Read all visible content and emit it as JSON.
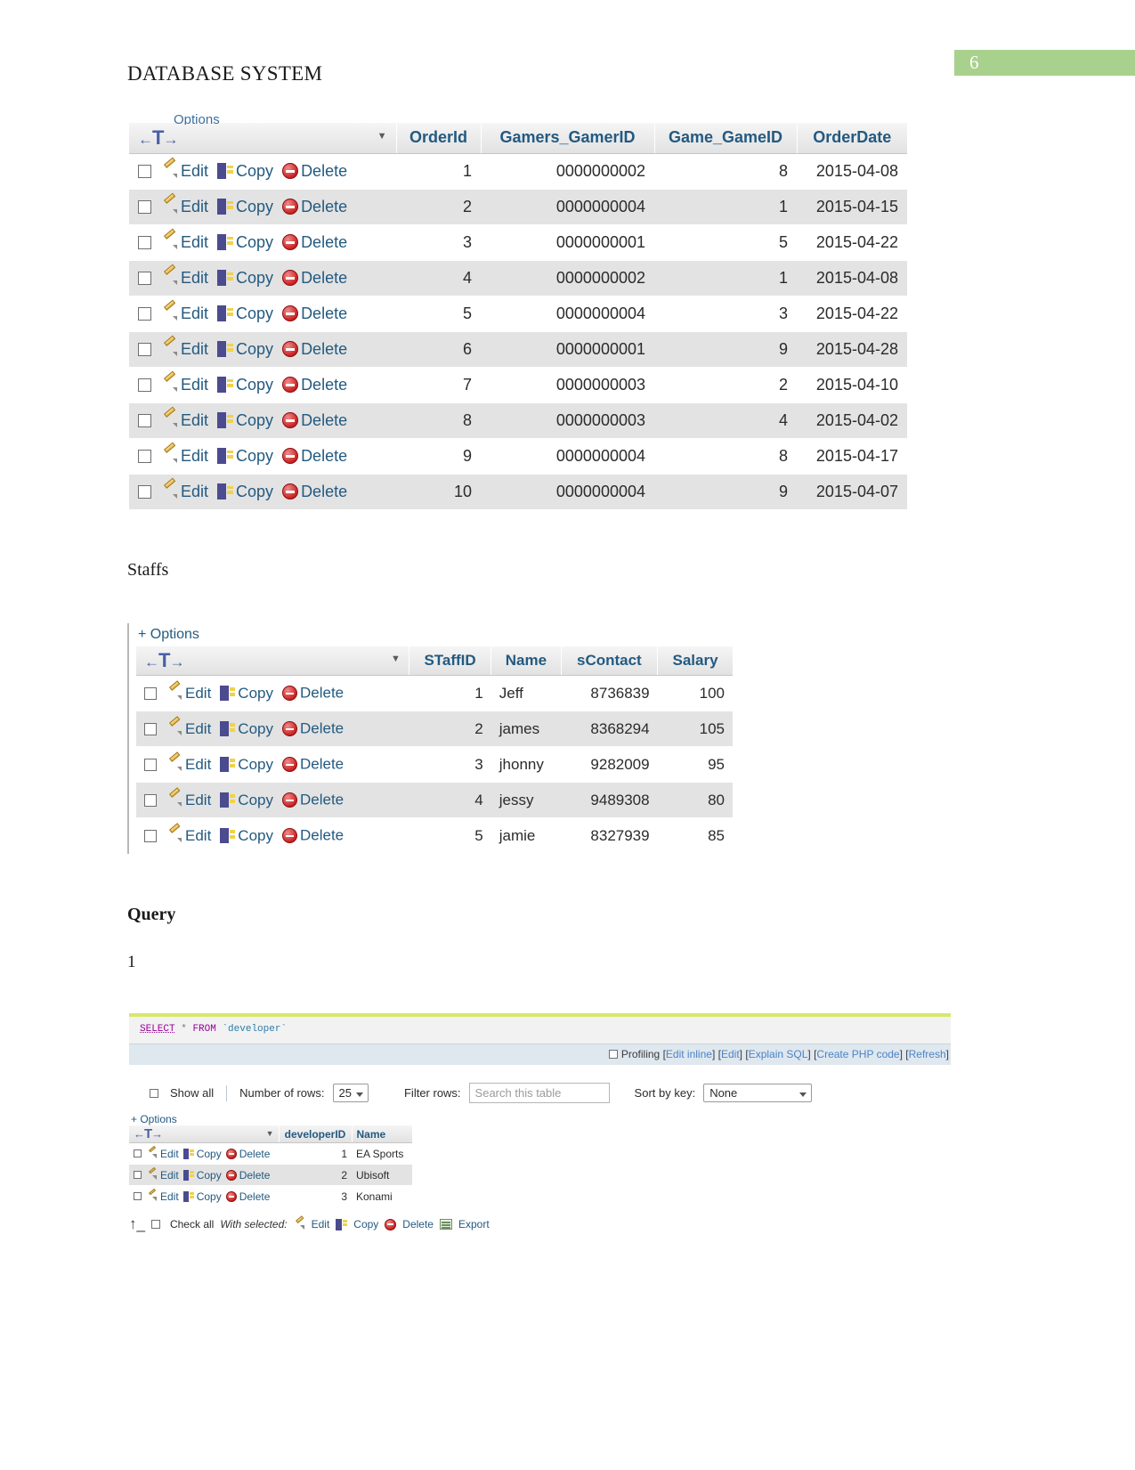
{
  "page": {
    "badge_number": "6",
    "doc_title": "DATABASE SYSTEM"
  },
  "orders": {
    "options_label": "Options",
    "nav_left": "←",
    "nav_t": "T",
    "nav_right": "→",
    "caret": "▼",
    "row_actions": {
      "edit": "Edit",
      "copy": "Copy",
      "delete": "Delete"
    },
    "columns": [
      "OrderId",
      "Gamers_GamerID",
      "Game_GameID",
      "OrderDate"
    ],
    "rows": [
      {
        "OrderId": "1",
        "Gamers_GamerID": "0000000002",
        "Game_GameID": "8",
        "OrderDate": "2015-04-08"
      },
      {
        "OrderId": "2",
        "Gamers_GamerID": "0000000004",
        "Game_GameID": "1",
        "OrderDate": "2015-04-15"
      },
      {
        "OrderId": "3",
        "Gamers_GamerID": "0000000001",
        "Game_GameID": "5",
        "OrderDate": "2015-04-22"
      },
      {
        "OrderId": "4",
        "Gamers_GamerID": "0000000002",
        "Game_GameID": "1",
        "OrderDate": "2015-04-08"
      },
      {
        "OrderId": "5",
        "Gamers_GamerID": "0000000004",
        "Game_GameID": "3",
        "OrderDate": "2015-04-22"
      },
      {
        "OrderId": "6",
        "Gamers_GamerID": "0000000001",
        "Game_GameID": "9",
        "OrderDate": "2015-04-28"
      },
      {
        "OrderId": "7",
        "Gamers_GamerID": "0000000003",
        "Game_GameID": "2",
        "OrderDate": "2015-04-10"
      },
      {
        "OrderId": "8",
        "Gamers_GamerID": "0000000003",
        "Game_GameID": "4",
        "OrderDate": "2015-04-02"
      },
      {
        "OrderId": "9",
        "Gamers_GamerID": "0000000004",
        "Game_GameID": "8",
        "OrderDate": "2015-04-17"
      },
      {
        "OrderId": "10",
        "Gamers_GamerID": "0000000004",
        "Game_GameID": "9",
        "OrderDate": "2015-04-07"
      }
    ]
  },
  "staffs": {
    "heading": "Staffs",
    "options_label": "+ Options",
    "nav_left": "←",
    "nav_t": "T",
    "nav_right": "→",
    "caret": "▼",
    "row_actions": {
      "edit": "Edit",
      "copy": "Copy",
      "delete": "Delete"
    },
    "columns": [
      "STaffID",
      "Name",
      "sContact",
      "Salary"
    ],
    "rows": [
      {
        "STaffID": "1",
        "Name": "Jeff",
        "sContact": "8736839",
        "Salary": "100"
      },
      {
        "STaffID": "2",
        "Name": "james",
        "sContact": "8368294",
        "Salary": "105"
      },
      {
        "STaffID": "3",
        "Name": "jhonny",
        "sContact": "9282009",
        "Salary": "95"
      },
      {
        "STaffID": "4",
        "Name": "jessy",
        "sContact": "9489308",
        "Salary": "80"
      },
      {
        "STaffID": "5",
        "Name": "jamie",
        "sContact": "8327939",
        "Salary": "85"
      }
    ]
  },
  "query_section": {
    "heading": "Query",
    "number": "1",
    "sql": {
      "keyword_select": "SELECT",
      "star": "*",
      "keyword_from": "FROM",
      "table_ref": "`developer`"
    },
    "sql_links": {
      "profiling": "Profiling",
      "edit_inline": "Edit inline",
      "edit": "Edit",
      "explain_sql": "Explain SQL",
      "create_php": "Create PHP code",
      "refresh": "Refresh"
    },
    "controls": {
      "show_all": "Show all",
      "number_of_rows_label": "Number of rows:",
      "number_of_rows_value": "25",
      "filter_rows_label": "Filter rows:",
      "filter_placeholder": "Search this table",
      "sort_by_key_label": "Sort by key:",
      "sort_by_key_value": "None"
    },
    "result": {
      "options_label": "+ Options",
      "nav_left": "←",
      "nav_t": "T",
      "nav_right": "→",
      "caret": "▼",
      "row_actions": {
        "edit": "Edit",
        "copy": "Copy",
        "delete": "Delete"
      },
      "columns": [
        "developerID",
        "Name"
      ],
      "rows": [
        {
          "developerID": "1",
          "Name": "EA Sports"
        },
        {
          "developerID": "2",
          "Name": "Ubisoft"
        },
        {
          "developerID": "3",
          "Name": "Konami"
        }
      ]
    },
    "footer": {
      "check_all": "Check all",
      "with_selected": "With selected:",
      "edit": "Edit",
      "copy": "Copy",
      "delete": "Delete",
      "export": "Export"
    }
  },
  "colors": {
    "badge_green": "#a9d18e",
    "link_blue": "#235a81",
    "sql_accent": "#d7e86a"
  }
}
